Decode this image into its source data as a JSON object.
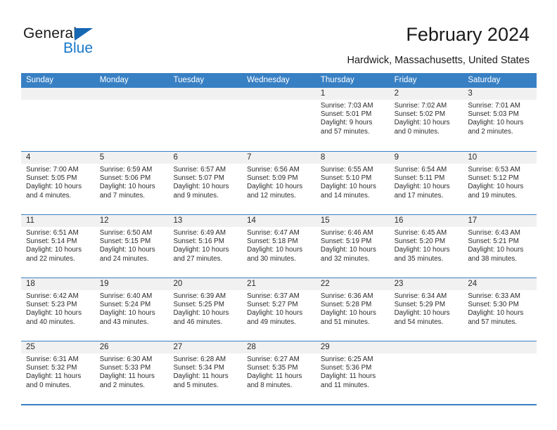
{
  "brand": {
    "word1": "General",
    "word2": "Blue",
    "triangle_color": "#1668b3",
    "blue_color": "#1877c9"
  },
  "header": {
    "title": "February 2024",
    "location": "Hardwick, Massachusetts, United States"
  },
  "colors": {
    "header_blue": "#3880c4",
    "date_band": "#f1f1f1",
    "text": "#2b2b2b"
  },
  "weekdays": [
    "Sunday",
    "Monday",
    "Tuesday",
    "Wednesday",
    "Thursday",
    "Friday",
    "Saturday"
  ],
  "weeks": [
    [
      {
        "day": "",
        "empty": true,
        "l1": "",
        "l2": "",
        "l3": "",
        "l4": ""
      },
      {
        "day": "",
        "empty": true,
        "l1": "",
        "l2": "",
        "l3": "",
        "l4": ""
      },
      {
        "day": "",
        "empty": true,
        "l1": "",
        "l2": "",
        "l3": "",
        "l4": ""
      },
      {
        "day": "",
        "empty": true,
        "l1": "",
        "l2": "",
        "l3": "",
        "l4": ""
      },
      {
        "day": "1",
        "empty": false,
        "l1": "Sunrise: 7:03 AM",
        "l2": "Sunset: 5:01 PM",
        "l3": "Daylight: 9 hours",
        "l4": "and 57 minutes."
      },
      {
        "day": "2",
        "empty": false,
        "l1": "Sunrise: 7:02 AM",
        "l2": "Sunset: 5:02 PM",
        "l3": "Daylight: 10 hours",
        "l4": "and 0 minutes."
      },
      {
        "day": "3",
        "empty": false,
        "l1": "Sunrise: 7:01 AM",
        "l2": "Sunset: 5:03 PM",
        "l3": "Daylight: 10 hours",
        "l4": "and 2 minutes."
      }
    ],
    [
      {
        "day": "4",
        "empty": false,
        "l1": "Sunrise: 7:00 AM",
        "l2": "Sunset: 5:05 PM",
        "l3": "Daylight: 10 hours",
        "l4": "and 4 minutes."
      },
      {
        "day": "5",
        "empty": false,
        "l1": "Sunrise: 6:59 AM",
        "l2": "Sunset: 5:06 PM",
        "l3": "Daylight: 10 hours",
        "l4": "and 7 minutes."
      },
      {
        "day": "6",
        "empty": false,
        "l1": "Sunrise: 6:57 AM",
        "l2": "Sunset: 5:07 PM",
        "l3": "Daylight: 10 hours",
        "l4": "and 9 minutes."
      },
      {
        "day": "7",
        "empty": false,
        "l1": "Sunrise: 6:56 AM",
        "l2": "Sunset: 5:09 PM",
        "l3": "Daylight: 10 hours",
        "l4": "and 12 minutes."
      },
      {
        "day": "8",
        "empty": false,
        "l1": "Sunrise: 6:55 AM",
        "l2": "Sunset: 5:10 PM",
        "l3": "Daylight: 10 hours",
        "l4": "and 14 minutes."
      },
      {
        "day": "9",
        "empty": false,
        "l1": "Sunrise: 6:54 AM",
        "l2": "Sunset: 5:11 PM",
        "l3": "Daylight: 10 hours",
        "l4": "and 17 minutes."
      },
      {
        "day": "10",
        "empty": false,
        "l1": "Sunrise: 6:53 AM",
        "l2": "Sunset: 5:12 PM",
        "l3": "Daylight: 10 hours",
        "l4": "and 19 minutes."
      }
    ],
    [
      {
        "day": "11",
        "empty": false,
        "l1": "Sunrise: 6:51 AM",
        "l2": "Sunset: 5:14 PM",
        "l3": "Daylight: 10 hours",
        "l4": "and 22 minutes."
      },
      {
        "day": "12",
        "empty": false,
        "l1": "Sunrise: 6:50 AM",
        "l2": "Sunset: 5:15 PM",
        "l3": "Daylight: 10 hours",
        "l4": "and 24 minutes."
      },
      {
        "day": "13",
        "empty": false,
        "l1": "Sunrise: 6:49 AM",
        "l2": "Sunset: 5:16 PM",
        "l3": "Daylight: 10 hours",
        "l4": "and 27 minutes."
      },
      {
        "day": "14",
        "empty": false,
        "l1": "Sunrise: 6:47 AM",
        "l2": "Sunset: 5:18 PM",
        "l3": "Daylight: 10 hours",
        "l4": "and 30 minutes."
      },
      {
        "day": "15",
        "empty": false,
        "l1": "Sunrise: 6:46 AM",
        "l2": "Sunset: 5:19 PM",
        "l3": "Daylight: 10 hours",
        "l4": "and 32 minutes."
      },
      {
        "day": "16",
        "empty": false,
        "l1": "Sunrise: 6:45 AM",
        "l2": "Sunset: 5:20 PM",
        "l3": "Daylight: 10 hours",
        "l4": "and 35 minutes."
      },
      {
        "day": "17",
        "empty": false,
        "l1": "Sunrise: 6:43 AM",
        "l2": "Sunset: 5:21 PM",
        "l3": "Daylight: 10 hours",
        "l4": "and 38 minutes."
      }
    ],
    [
      {
        "day": "18",
        "empty": false,
        "l1": "Sunrise: 6:42 AM",
        "l2": "Sunset: 5:23 PM",
        "l3": "Daylight: 10 hours",
        "l4": "and 40 minutes."
      },
      {
        "day": "19",
        "empty": false,
        "l1": "Sunrise: 6:40 AM",
        "l2": "Sunset: 5:24 PM",
        "l3": "Daylight: 10 hours",
        "l4": "and 43 minutes."
      },
      {
        "day": "20",
        "empty": false,
        "l1": "Sunrise: 6:39 AM",
        "l2": "Sunset: 5:25 PM",
        "l3": "Daylight: 10 hours",
        "l4": "and 46 minutes."
      },
      {
        "day": "21",
        "empty": false,
        "l1": "Sunrise: 6:37 AM",
        "l2": "Sunset: 5:27 PM",
        "l3": "Daylight: 10 hours",
        "l4": "and 49 minutes."
      },
      {
        "day": "22",
        "empty": false,
        "l1": "Sunrise: 6:36 AM",
        "l2": "Sunset: 5:28 PM",
        "l3": "Daylight: 10 hours",
        "l4": "and 51 minutes."
      },
      {
        "day": "23",
        "empty": false,
        "l1": "Sunrise: 6:34 AM",
        "l2": "Sunset: 5:29 PM",
        "l3": "Daylight: 10 hours",
        "l4": "and 54 minutes."
      },
      {
        "day": "24",
        "empty": false,
        "l1": "Sunrise: 6:33 AM",
        "l2": "Sunset: 5:30 PM",
        "l3": "Daylight: 10 hours",
        "l4": "and 57 minutes."
      }
    ],
    [
      {
        "day": "25",
        "empty": false,
        "l1": "Sunrise: 6:31 AM",
        "l2": "Sunset: 5:32 PM",
        "l3": "Daylight: 11 hours",
        "l4": "and 0 minutes."
      },
      {
        "day": "26",
        "empty": false,
        "l1": "Sunrise: 6:30 AM",
        "l2": "Sunset: 5:33 PM",
        "l3": "Daylight: 11 hours",
        "l4": "and 2 minutes."
      },
      {
        "day": "27",
        "empty": false,
        "l1": "Sunrise: 6:28 AM",
        "l2": "Sunset: 5:34 PM",
        "l3": "Daylight: 11 hours",
        "l4": "and 5 minutes."
      },
      {
        "day": "28",
        "empty": false,
        "l1": "Sunrise: 6:27 AM",
        "l2": "Sunset: 5:35 PM",
        "l3": "Daylight: 11 hours",
        "l4": "and 8 minutes."
      },
      {
        "day": "29",
        "empty": false,
        "l1": "Sunrise: 6:25 AM",
        "l2": "Sunset: 5:36 PM",
        "l3": "Daylight: 11 hours",
        "l4": "and 11 minutes."
      },
      {
        "day": "",
        "empty": true,
        "l1": "",
        "l2": "",
        "l3": "",
        "l4": ""
      },
      {
        "day": "",
        "empty": true,
        "l1": "",
        "l2": "",
        "l3": "",
        "l4": ""
      }
    ]
  ]
}
